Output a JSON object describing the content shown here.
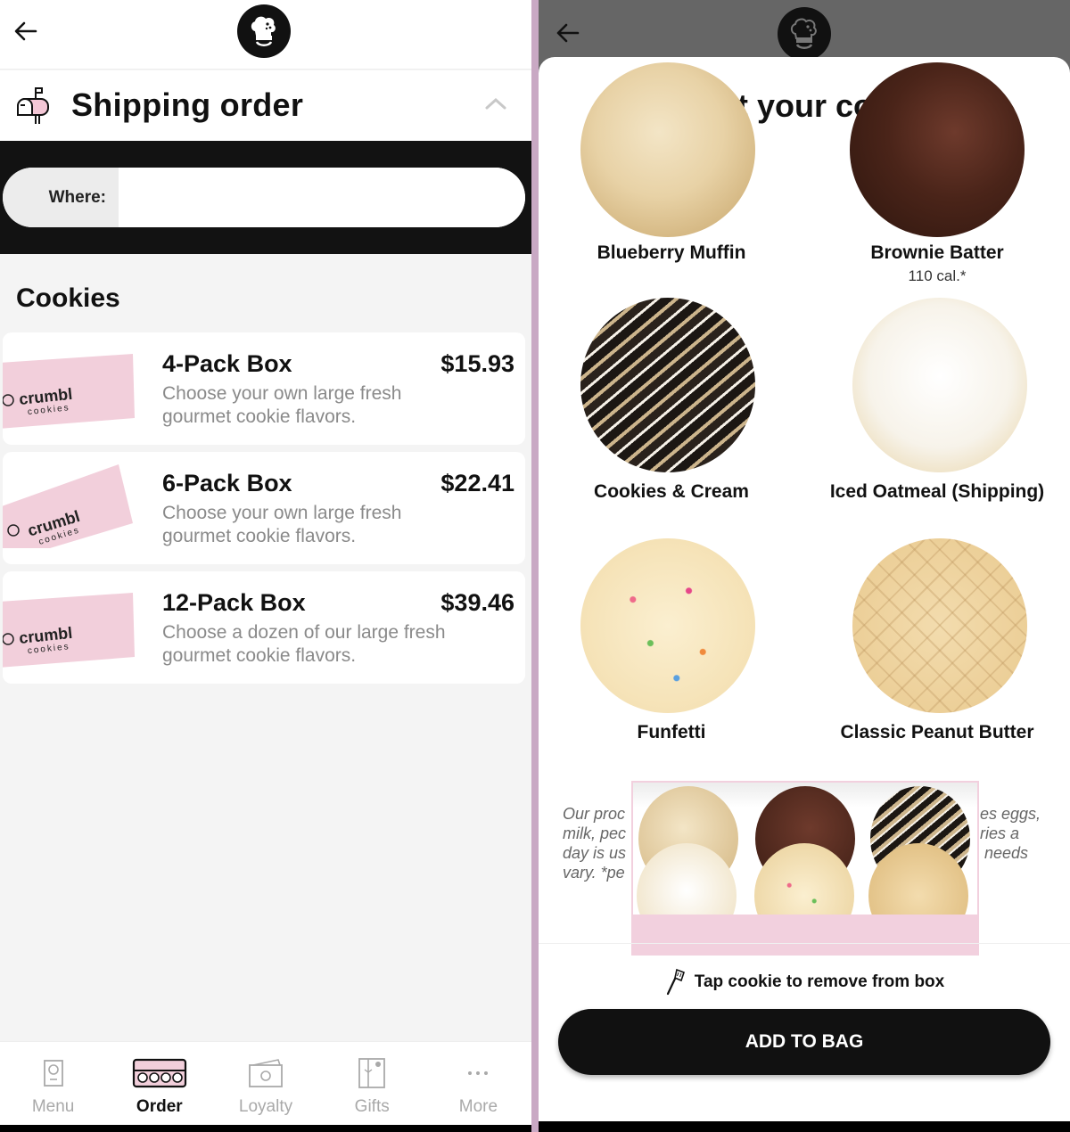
{
  "left": {
    "header": {
      "back_icon": "arrow-left-icon",
      "logo_icon": "crumbl-chef-logo"
    },
    "shipping": {
      "icon": "mailbox-icon",
      "title": "Shipping order",
      "collapse_icon": "chevron-up-icon"
    },
    "where": {
      "label": "Where:",
      "value": ""
    },
    "section_title": "Cookies",
    "products": [
      {
        "title": "4-Pack Box",
        "price": "$15.93",
        "description": "Choose your own large fresh gourmet cookie flavors.",
        "brand": "crumbl",
        "brand_sub": "cookies"
      },
      {
        "title": "6-Pack Box",
        "price": "$22.41",
        "description": "Choose your own large fresh gourmet cookie flavors.",
        "brand": "crumbl",
        "brand_sub": "cookies"
      },
      {
        "title": "12-Pack Box",
        "price": "$39.46",
        "description": "Choose a dozen of our large fresh gourmet cookie flavors.",
        "brand": "crumbl",
        "brand_sub": "cookies"
      }
    ],
    "nav": [
      {
        "label": "Menu",
        "icon": "menu-card-icon",
        "active": false
      },
      {
        "label": "Order",
        "icon": "cookie-box-icon",
        "active": true
      },
      {
        "label": "Loyalty",
        "icon": "loyalty-cash-icon",
        "active": false
      },
      {
        "label": "Gifts",
        "icon": "gift-card-icon",
        "active": false
      },
      {
        "label": "More",
        "icon": "more-dots-icon",
        "active": false
      }
    ]
  },
  "right": {
    "header": {
      "back_icon": "arrow-left-icon",
      "logo_icon": "crumbl-chef-logo"
    },
    "title": "Select your cookies",
    "cookies": [
      {
        "name": "Blueberry Muffin",
        "calories": ""
      },
      {
        "name": "Brownie Batter",
        "calories": "110 cal.*"
      },
      {
        "name": "Cookies & Cream",
        "calories": ""
      },
      {
        "name": "Iced Oatmeal (Shipping)",
        "calories": ""
      },
      {
        "name": "Funfetti",
        "calories": ""
      },
      {
        "name": "Classic Peanut Butter",
        "calories": ""
      }
    ],
    "disclaimer_left": "Our proc\nmilk, pec\nday is us\nvary. *pe",
    "disclaimer_right": "es eggs,\nries a\n needs",
    "box_count": 6,
    "tap_hint": "Tap cookie to remove from box",
    "tap_icon": "spatula-icon",
    "add_button": "ADD TO BAG"
  },
  "colors": {
    "brand_pink": "#f2d0de",
    "dark": "#111111",
    "muted_text": "#8a8a8a",
    "overlay": "#666666",
    "divider": "#c9a9c4"
  }
}
